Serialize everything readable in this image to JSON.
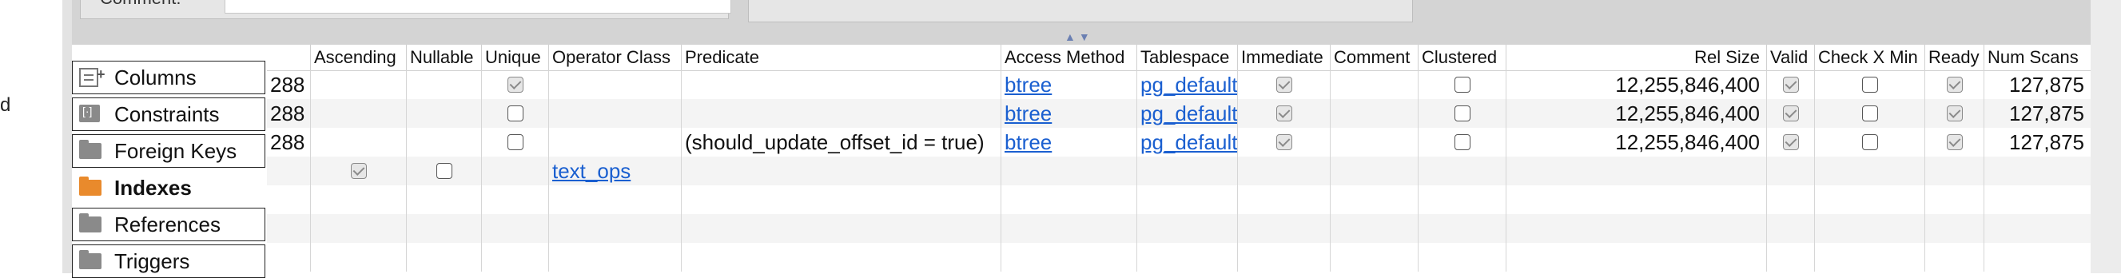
{
  "left_fragment": "d",
  "comment_label": "Comment:",
  "nav": [
    {
      "label": "Columns",
      "icon": "columns-icon"
    },
    {
      "label": "Constraints",
      "icon": "constraints-icon"
    },
    {
      "label": "Foreign Keys",
      "icon": "folder-icon"
    },
    {
      "label": "Indexes",
      "icon": "folder-icon",
      "active": true
    },
    {
      "label": "References",
      "icon": "folder-icon"
    },
    {
      "label": "Triggers",
      "icon": "folder-icon"
    }
  ],
  "columns": [
    "",
    "Ascending",
    "Nullable",
    "Unique",
    "Operator Class",
    "Predicate",
    "Access Method",
    "Tablespace",
    "Immediate",
    "Comment",
    "Clustered",
    "Rel Size",
    "Valid",
    "Check X Min",
    "Ready",
    "Num Scans"
  ],
  "rows": [
    {
      "c0": "288",
      "unique": false,
      "predicate": "",
      "access_method": "btree",
      "tablespace": "pg_default",
      "immediate": true,
      "clustered": false,
      "rel_size": "12,255,846,400",
      "valid": true,
      "check_x_min": false,
      "ready": true,
      "num_scans": "127,875"
    },
    {
      "c0": "288",
      "unique": false,
      "predicate": "",
      "access_method": "btree",
      "tablespace": "pg_default",
      "immediate": true,
      "clustered": false,
      "rel_size": "12,255,846,400",
      "valid": true,
      "check_x_min": false,
      "ready": true,
      "num_scans": "127,875"
    },
    {
      "c0": "288",
      "unique": false,
      "predicate": "(should_update_offset_id = true)",
      "access_method": "btree",
      "tablespace": "pg_default",
      "immediate": true,
      "clustered": false,
      "rel_size": "12,255,846,400",
      "valid": true,
      "check_x_min": false,
      "ready": true,
      "num_scans": "127,875"
    },
    {
      "ascending": true,
      "nullable": false,
      "operator_class": "text_ops"
    }
  ]
}
